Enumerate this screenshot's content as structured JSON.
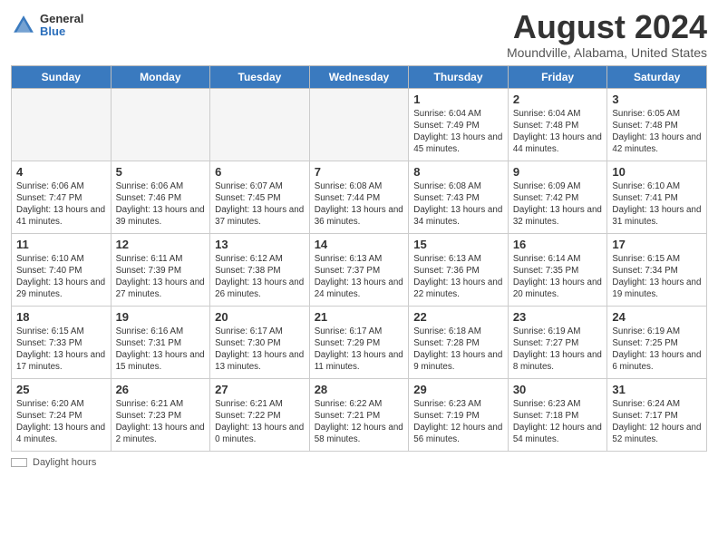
{
  "logo": {
    "general": "General",
    "blue": "Blue"
  },
  "title": "August 2024",
  "location": "Moundville, Alabama, United States",
  "days_of_week": [
    "Sunday",
    "Monday",
    "Tuesday",
    "Wednesday",
    "Thursday",
    "Friday",
    "Saturday"
  ],
  "footer": {
    "label": "Daylight hours"
  },
  "weeks": [
    [
      {
        "day": "",
        "info": ""
      },
      {
        "day": "",
        "info": ""
      },
      {
        "day": "",
        "info": ""
      },
      {
        "day": "",
        "info": ""
      },
      {
        "day": "1",
        "info": "Sunrise: 6:04 AM\nSunset: 7:49 PM\nDaylight: 13 hours\nand 45 minutes."
      },
      {
        "day": "2",
        "info": "Sunrise: 6:04 AM\nSunset: 7:48 PM\nDaylight: 13 hours\nand 44 minutes."
      },
      {
        "day": "3",
        "info": "Sunrise: 6:05 AM\nSunset: 7:48 PM\nDaylight: 13 hours\nand 42 minutes."
      }
    ],
    [
      {
        "day": "4",
        "info": "Sunrise: 6:06 AM\nSunset: 7:47 PM\nDaylight: 13 hours\nand 41 minutes."
      },
      {
        "day": "5",
        "info": "Sunrise: 6:06 AM\nSunset: 7:46 PM\nDaylight: 13 hours\nand 39 minutes."
      },
      {
        "day": "6",
        "info": "Sunrise: 6:07 AM\nSunset: 7:45 PM\nDaylight: 13 hours\nand 37 minutes."
      },
      {
        "day": "7",
        "info": "Sunrise: 6:08 AM\nSunset: 7:44 PM\nDaylight: 13 hours\nand 36 minutes."
      },
      {
        "day": "8",
        "info": "Sunrise: 6:08 AM\nSunset: 7:43 PM\nDaylight: 13 hours\nand 34 minutes."
      },
      {
        "day": "9",
        "info": "Sunrise: 6:09 AM\nSunset: 7:42 PM\nDaylight: 13 hours\nand 32 minutes."
      },
      {
        "day": "10",
        "info": "Sunrise: 6:10 AM\nSunset: 7:41 PM\nDaylight: 13 hours\nand 31 minutes."
      }
    ],
    [
      {
        "day": "11",
        "info": "Sunrise: 6:10 AM\nSunset: 7:40 PM\nDaylight: 13 hours\nand 29 minutes."
      },
      {
        "day": "12",
        "info": "Sunrise: 6:11 AM\nSunset: 7:39 PM\nDaylight: 13 hours\nand 27 minutes."
      },
      {
        "day": "13",
        "info": "Sunrise: 6:12 AM\nSunset: 7:38 PM\nDaylight: 13 hours\nand 26 minutes."
      },
      {
        "day": "14",
        "info": "Sunrise: 6:13 AM\nSunset: 7:37 PM\nDaylight: 13 hours\nand 24 minutes."
      },
      {
        "day": "15",
        "info": "Sunrise: 6:13 AM\nSunset: 7:36 PM\nDaylight: 13 hours\nand 22 minutes."
      },
      {
        "day": "16",
        "info": "Sunrise: 6:14 AM\nSunset: 7:35 PM\nDaylight: 13 hours\nand 20 minutes."
      },
      {
        "day": "17",
        "info": "Sunrise: 6:15 AM\nSunset: 7:34 PM\nDaylight: 13 hours\nand 19 minutes."
      }
    ],
    [
      {
        "day": "18",
        "info": "Sunrise: 6:15 AM\nSunset: 7:33 PM\nDaylight: 13 hours\nand 17 minutes."
      },
      {
        "day": "19",
        "info": "Sunrise: 6:16 AM\nSunset: 7:31 PM\nDaylight: 13 hours\nand 15 minutes."
      },
      {
        "day": "20",
        "info": "Sunrise: 6:17 AM\nSunset: 7:30 PM\nDaylight: 13 hours\nand 13 minutes."
      },
      {
        "day": "21",
        "info": "Sunrise: 6:17 AM\nSunset: 7:29 PM\nDaylight: 13 hours\nand 11 minutes."
      },
      {
        "day": "22",
        "info": "Sunrise: 6:18 AM\nSunset: 7:28 PM\nDaylight: 13 hours\nand 9 minutes."
      },
      {
        "day": "23",
        "info": "Sunrise: 6:19 AM\nSunset: 7:27 PM\nDaylight: 13 hours\nand 8 minutes."
      },
      {
        "day": "24",
        "info": "Sunrise: 6:19 AM\nSunset: 7:25 PM\nDaylight: 13 hours\nand 6 minutes."
      }
    ],
    [
      {
        "day": "25",
        "info": "Sunrise: 6:20 AM\nSunset: 7:24 PM\nDaylight: 13 hours\nand 4 minutes."
      },
      {
        "day": "26",
        "info": "Sunrise: 6:21 AM\nSunset: 7:23 PM\nDaylight: 13 hours\nand 2 minutes."
      },
      {
        "day": "27",
        "info": "Sunrise: 6:21 AM\nSunset: 7:22 PM\nDaylight: 13 hours\nand 0 minutes."
      },
      {
        "day": "28",
        "info": "Sunrise: 6:22 AM\nSunset: 7:21 PM\nDaylight: 12 hours\nand 58 minutes."
      },
      {
        "day": "29",
        "info": "Sunrise: 6:23 AM\nSunset: 7:19 PM\nDaylight: 12 hours\nand 56 minutes."
      },
      {
        "day": "30",
        "info": "Sunrise: 6:23 AM\nSunset: 7:18 PM\nDaylight: 12 hours\nand 54 minutes."
      },
      {
        "day": "31",
        "info": "Sunrise: 6:24 AM\nSunset: 7:17 PM\nDaylight: 12 hours\nand 52 minutes."
      }
    ]
  ]
}
